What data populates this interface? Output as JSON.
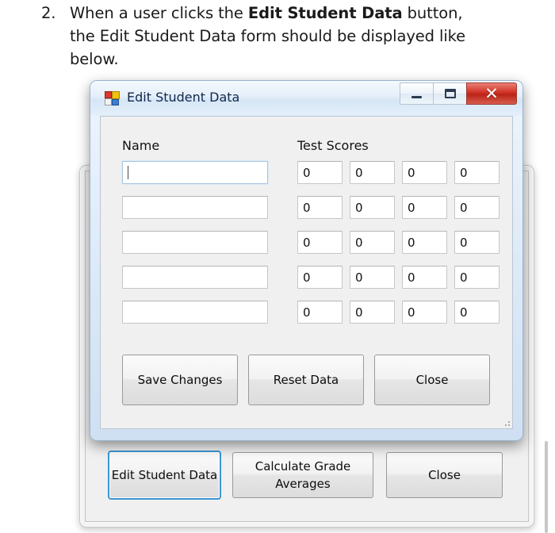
{
  "document": {
    "list_number": "2.",
    "line1_pre": "When a user clicks the ",
    "line1_bold": "Edit Student Data",
    "line1_post": " button,",
    "line2": "the Edit Student Data form should be displayed like",
    "line3": "below."
  },
  "dialog": {
    "title": "Edit Student Data",
    "icon": "winforms-icon",
    "caption": {
      "minimize": "minimize-icon",
      "maximize": "restore-icon",
      "close": "✕"
    },
    "labels": {
      "name": "Name",
      "test_scores": "Test Scores"
    },
    "rows": [
      {
        "name": "",
        "focused": true,
        "scores": [
          "0",
          "0",
          "0",
          "0"
        ]
      },
      {
        "name": "",
        "focused": false,
        "scores": [
          "0",
          "0",
          "0",
          "0"
        ]
      },
      {
        "name": "",
        "focused": false,
        "scores": [
          "0",
          "0",
          "0",
          "0"
        ]
      },
      {
        "name": "",
        "focused": false,
        "scores": [
          "0",
          "0",
          "0",
          "0"
        ]
      },
      {
        "name": "",
        "focused": false,
        "scores": [
          "0",
          "0",
          "0",
          "0"
        ]
      }
    ],
    "buttons": {
      "save": "Save Changes",
      "reset": "Reset Data",
      "close": "Close"
    }
  },
  "background_window": {
    "buttons": {
      "edit": "Edit Student Data",
      "calculate": "Calculate Grade Averages",
      "close": "Close"
    },
    "focused_button": "edit"
  },
  "colors": {
    "titlebar_blue": "#dce9f7",
    "close_red": "#d4392c",
    "focus_blue": "#3c96d4",
    "form_gray": "#f0f0f0"
  }
}
